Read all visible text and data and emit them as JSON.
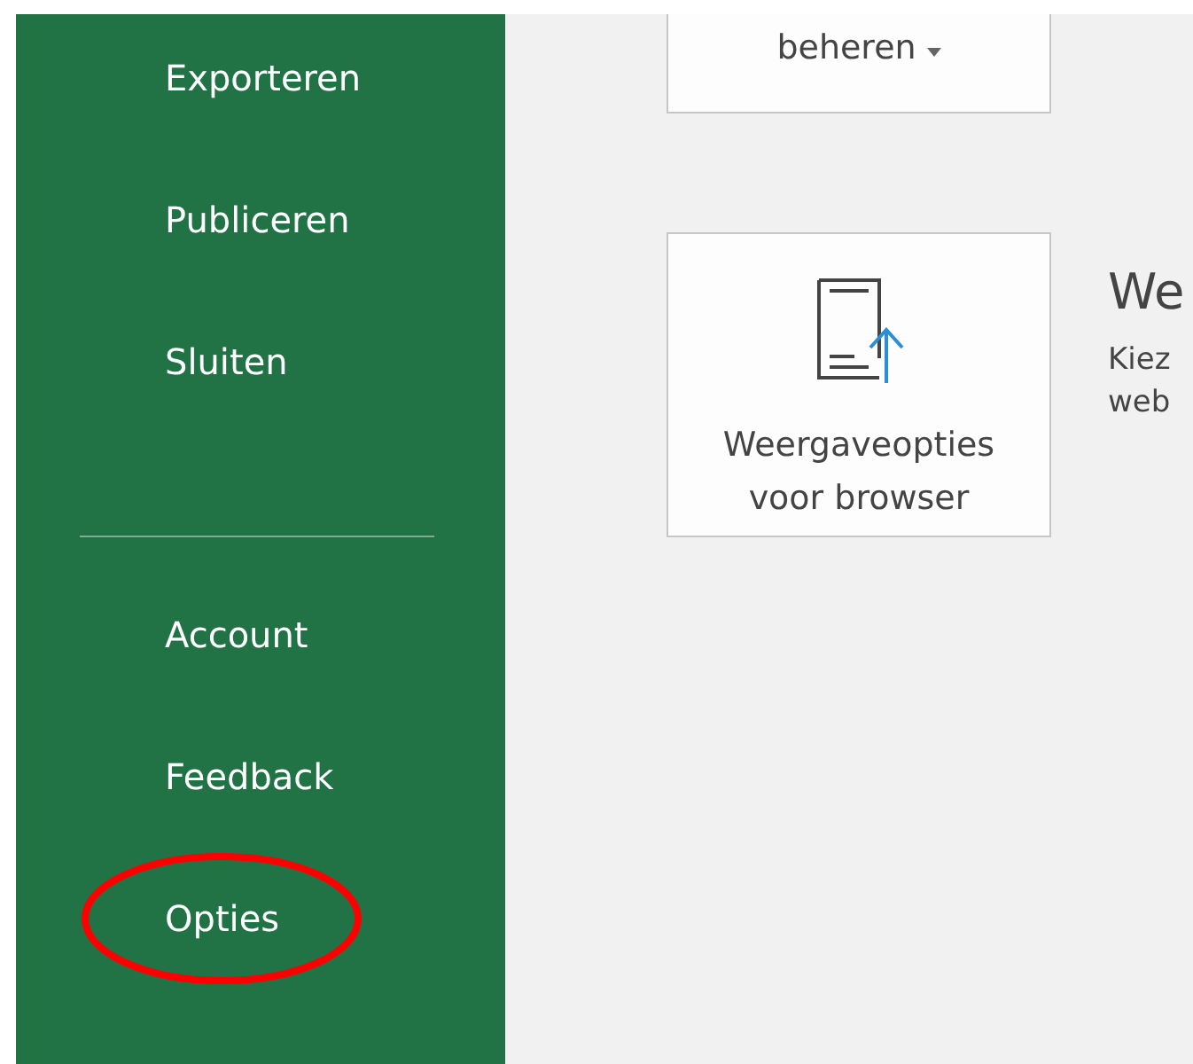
{
  "sidebar": {
    "items": [
      {
        "label": "Exporteren"
      },
      {
        "label": "Publiceren"
      },
      {
        "label": "Sluiten"
      }
    ],
    "bottom_items": [
      {
        "label": "Account",
        "highlighted": false
      },
      {
        "label": "Feedback",
        "highlighted": false
      },
      {
        "label": "Opties",
        "highlighted": true
      }
    ]
  },
  "buttons": [
    {
      "kind": "dropdown",
      "label": "beheren"
    },
    {
      "kind": "browser",
      "lines": [
        "Weergaveopties",
        "voor browser"
      ]
    }
  ],
  "section": {
    "title": "We",
    "description_lines": [
      "Kiez",
      "web"
    ]
  }
}
